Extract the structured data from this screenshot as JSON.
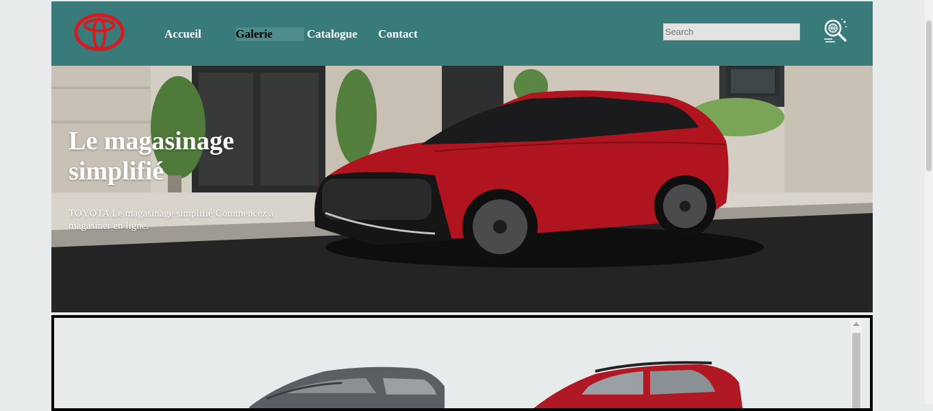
{
  "header": {
    "nav": [
      {
        "label": "Accueil"
      },
      {
        "label": "Galerie"
      },
      {
        "label": "Catalogue"
      },
      {
        "label": "Contact"
      }
    ],
    "search_placeholder": "Search",
    "logo_icon": "toyota-logo",
    "search_icon": "search-gear-icon",
    "brand_color": "#387b7a",
    "logo_color": "#d71920"
  },
  "hero": {
    "title": "Le magasinage simplifié",
    "text": "TOYOTA Le magasinage simplifié Commencez à magasiner en ligne."
  },
  "gallery": {
    "images": [
      "grey-toyota-suv",
      "red-toyota-suv"
    ]
  }
}
